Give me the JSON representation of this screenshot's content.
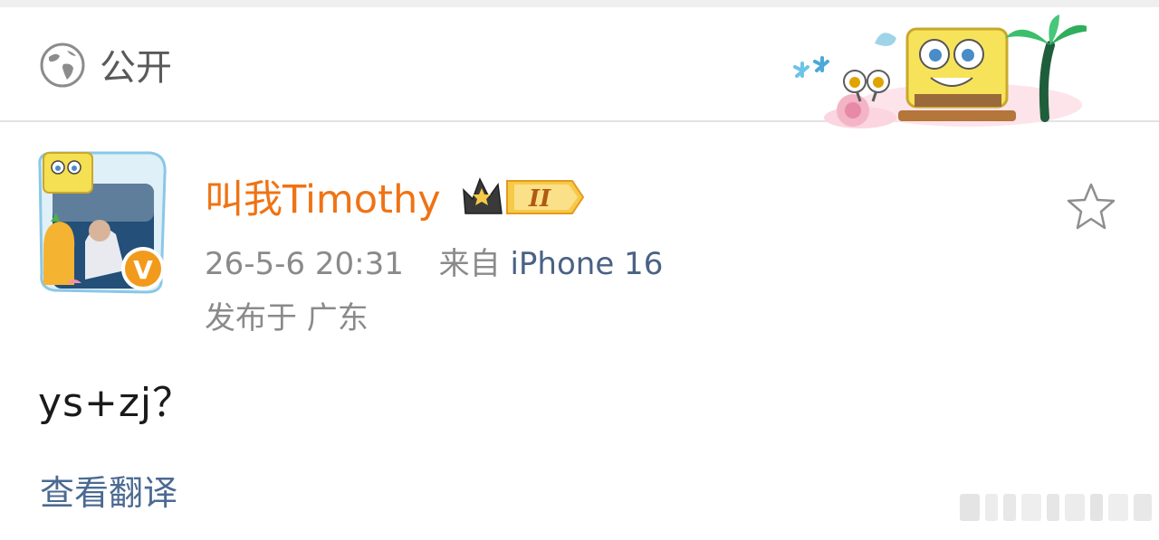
{
  "header": {
    "visibility_icon": "globe-icon",
    "visibility_label": "公开",
    "decoration": "spongebob-beach-banner"
  },
  "post": {
    "author": {
      "name": "叫我Timothy",
      "avatar": "avatar-photo-with-spongebob-frame",
      "verified_badge": "V",
      "level_badge": "II",
      "level_icon": "crown-icon"
    },
    "timestamp": "26-5-6 20:31",
    "source_prefix": "来自",
    "device": "iPhone 16",
    "location": "发布于 广东",
    "content": "ys+zj？",
    "translate_label": "查看翻译",
    "favorite_icon": "star-outline-icon"
  },
  "colors": {
    "username": "#ef7314",
    "link": "#4b6a92",
    "meta": "#8a8a8a",
    "badge_orange": "#f29a1b"
  }
}
